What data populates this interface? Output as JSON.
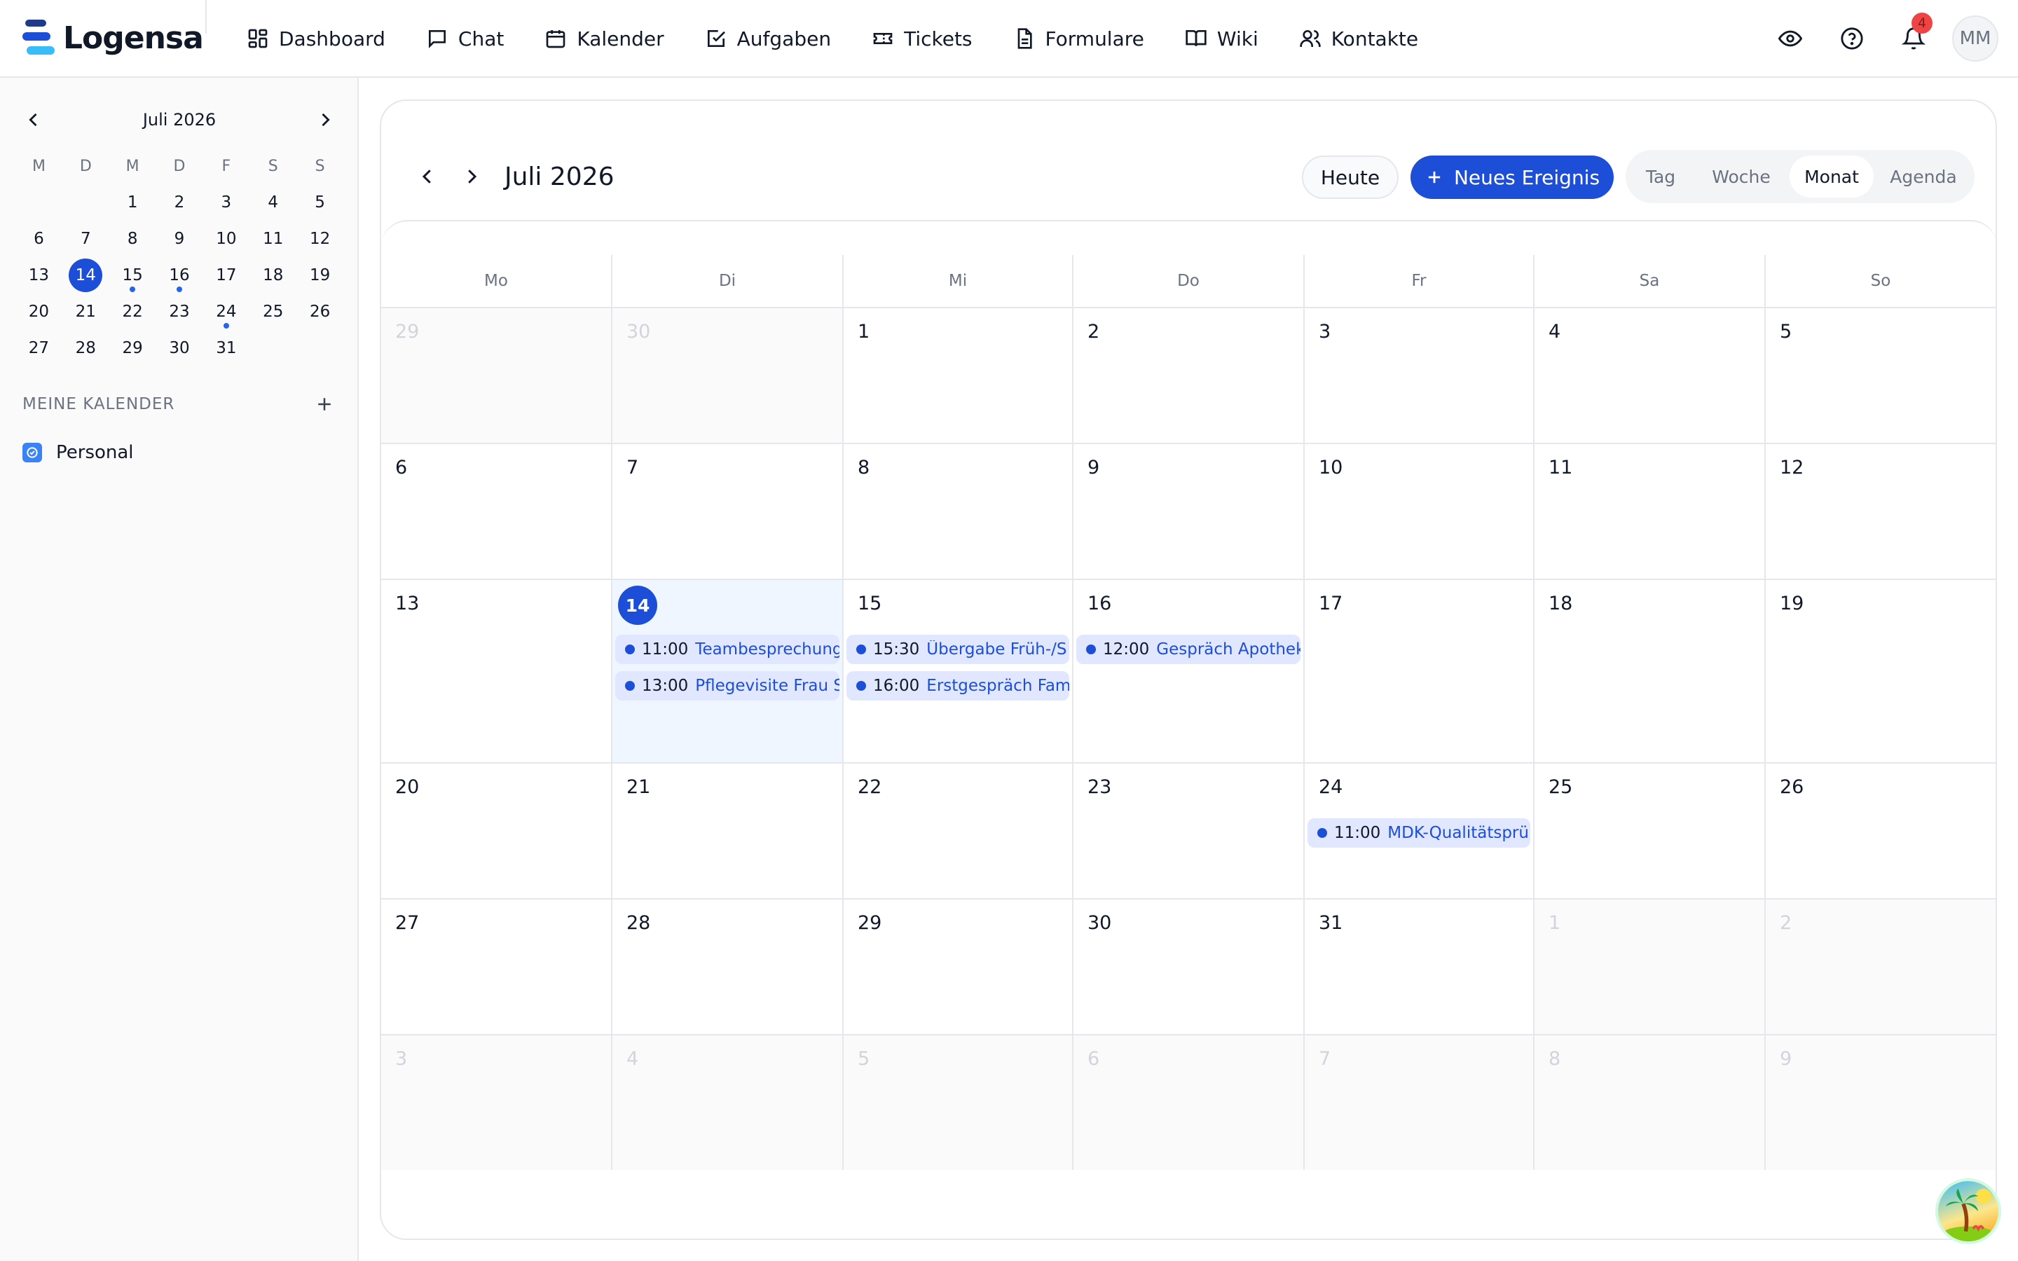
{
  "app": {
    "name": "Logensa"
  },
  "nav": [
    {
      "label": "Dashboard",
      "icon": "dashboard-icon"
    },
    {
      "label": "Chat",
      "icon": "chat-icon"
    },
    {
      "label": "Kalender",
      "icon": "calendar-icon"
    },
    {
      "label": "Aufgaben",
      "icon": "task-icon"
    },
    {
      "label": "Tickets",
      "icon": "ticket-icon"
    },
    {
      "label": "Formulare",
      "icon": "form-icon"
    },
    {
      "label": "Wiki",
      "icon": "book-icon"
    },
    {
      "label": "Kontakte",
      "icon": "contacts-icon"
    }
  ],
  "top_right": {
    "notification_count": "4",
    "avatar_initials": "MM"
  },
  "mini_calendar": {
    "title": "Juli 2026",
    "weekdays": [
      "M",
      "D",
      "M",
      "D",
      "F",
      "S",
      "S"
    ],
    "leading_blanks": 2,
    "days": [
      "1",
      "2",
      "3",
      "4",
      "5",
      "6",
      "7",
      "8",
      "9",
      "10",
      "11",
      "12",
      "13",
      "14",
      "15",
      "16",
      "17",
      "18",
      "19",
      "20",
      "21",
      "22",
      "23",
      "24",
      "25",
      "26",
      "27",
      "28",
      "29",
      "30",
      "31"
    ],
    "today": "14",
    "event_dots": [
      "15",
      "16",
      "24"
    ]
  },
  "my_calendars": {
    "title": "MEINE KALENDER",
    "items": [
      {
        "label": "Personal",
        "color": "#3b82f6"
      }
    ]
  },
  "toolbar": {
    "title": "Juli 2026",
    "today_label": "Heute",
    "new_event_label": "Neues Ereignis",
    "views": [
      "Tag",
      "Woche",
      "Monat",
      "Agenda"
    ],
    "active_view": "Monat"
  },
  "month": {
    "weekdays": [
      "Mo",
      "Di",
      "Mi",
      "Do",
      "Fr",
      "Sa",
      "So"
    ],
    "weeks": [
      [
        {
          "day": "29",
          "muted": true
        },
        {
          "day": "30",
          "muted": true
        },
        {
          "day": "1"
        },
        {
          "day": "2"
        },
        {
          "day": "3"
        },
        {
          "day": "4"
        },
        {
          "day": "5"
        }
      ],
      [
        {
          "day": "6"
        },
        {
          "day": "7"
        },
        {
          "day": "8"
        },
        {
          "day": "9"
        },
        {
          "day": "10"
        },
        {
          "day": "11"
        },
        {
          "day": "12"
        }
      ],
      [
        {
          "day": "13"
        },
        {
          "day": "14",
          "today": true,
          "events": [
            {
              "time": "11:00",
              "title": "Teambesprechung"
            },
            {
              "time": "13:00",
              "title": "Pflegevisite Frau S"
            }
          ]
        },
        {
          "day": "15",
          "events": [
            {
              "time": "15:30",
              "title": "Übergabe Früh-/S"
            },
            {
              "time": "16:00",
              "title": "Erstgespräch Fam"
            }
          ]
        },
        {
          "day": "16",
          "events": [
            {
              "time": "12:00",
              "title": "Gespräch Apothek"
            }
          ]
        },
        {
          "day": "17"
        },
        {
          "day": "18"
        },
        {
          "day": "19"
        }
      ],
      [
        {
          "day": "20"
        },
        {
          "day": "21"
        },
        {
          "day": "22"
        },
        {
          "day": "23"
        },
        {
          "day": "24",
          "events": [
            {
              "time": "11:00",
              "title": "MDK-Qualitätsprü"
            }
          ]
        },
        {
          "day": "25"
        },
        {
          "day": "26"
        }
      ],
      [
        {
          "day": "27"
        },
        {
          "day": "28"
        },
        {
          "day": "29"
        },
        {
          "day": "30"
        },
        {
          "day": "31"
        },
        {
          "day": "1",
          "muted": true
        },
        {
          "day": "2",
          "muted": true
        }
      ],
      [
        {
          "day": "3",
          "muted": true
        },
        {
          "day": "4",
          "muted": true
        },
        {
          "day": "5",
          "muted": true
        },
        {
          "day": "6",
          "muted": true
        },
        {
          "day": "7",
          "muted": true
        },
        {
          "day": "8",
          "muted": true
        },
        {
          "day": "9",
          "muted": true
        }
      ]
    ]
  },
  "colors": {
    "accent": "#1d4ed8",
    "event_bg": "#e0e7ff",
    "selected_day_bg": "#eff6ff",
    "badge": "#ef4444"
  }
}
